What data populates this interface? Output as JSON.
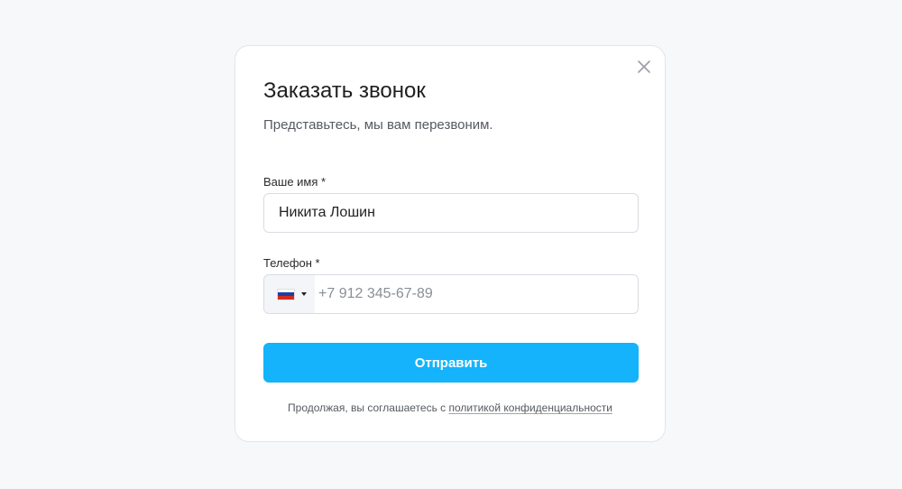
{
  "modal": {
    "title": "Заказать звонок",
    "subtitle": "Представьтесь, мы вам перезвоним.",
    "close_icon": "close-icon"
  },
  "form": {
    "name_label": "Ваше имя *",
    "name_value": "Никита Лошин",
    "phone_label": "Телефон *",
    "phone_country_flag": "russia-flag-icon",
    "phone_placeholder": "+7 912 345-67-89",
    "phone_value": "",
    "submit_label": "Отправить"
  },
  "consent": {
    "prefix": "Продолжая, вы соглашаетесь с ",
    "link_text": "политикой конфиденциальности"
  },
  "colors": {
    "background": "#f7f8fa",
    "button": "#14b3fb",
    "button_text": "#ffffff",
    "border": "#d9dce1"
  }
}
